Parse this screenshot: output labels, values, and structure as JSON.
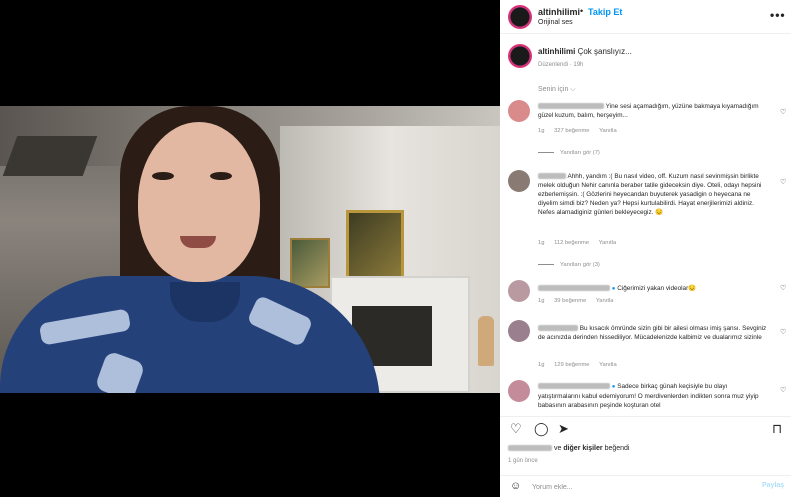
{
  "post": {
    "username": "altinhilimi",
    "follow_label": "Takip Et",
    "audio": "Orijinal ses",
    "more_label": "•••",
    "dot": "•"
  },
  "caption": {
    "username": "altinhilimi",
    "text": "Çok şanslıyız...",
    "meta": "Düzenlendi · 19h"
  },
  "sort_label": "Senin için ⌵",
  "comments": [
    {
      "username": "kullanici1",
      "text": "Yine sesi açamadığım, yüzüne bakmaya kıyamadığım güzel kuzum, balım, herşeyim...",
      "time": "1g",
      "likes": "327 beğenme",
      "reply": "Yanıtla",
      "view_replies": "Yanıtları gör (7)",
      "avatar_color": "#d98a8a"
    },
    {
      "username": "kullanici2",
      "text": "Ahhh, yandım :( Bu nasıl video, off. Kuzum nasıl sevinmişsin birlikte melek olduğun Nehir canınla beraber tatile gideceksin diye. Oteli, odayı hepsini ezberlemişsin. :( Gözlerini heyecandan buyuterek yasadigin o heyecana ne diyelim simdi biz? Neden ya? Hepsi kurtulabilirdi. Hayat enerjilerimizi aldiniz. Nefes alamadiginiz günleri bekleyecegiz. 😔",
      "time": "1g",
      "likes": "112 beğenme",
      "reply": "Yanıtla",
      "view_replies": "Yanıtları gör (3)",
      "avatar_color": "#8a7a74"
    },
    {
      "username": "kullanici3",
      "text": "Ciğerimizi yakan videolar😔",
      "time": "1g",
      "likes": "39 beğenme",
      "reply": "Yanıtla",
      "avatar_color": "#b89aa0"
    },
    {
      "username": "kullanici4",
      "text": "Bu kısacık ömründe sizin gibi bir ailesi olması imiş şansı. Sevginiz de acınızda derinden hissediliyor. Mücadelenizde kalbimiz ve dualarımız sizinle",
      "time": "1g",
      "likes": "129 beğenme",
      "reply": "Yanıtla",
      "avatar_color": "#9a7f8e"
    },
    {
      "username": "kullanici5",
      "text": "Sadece birkaç günah keçisiyle bu olayı yatıştırmalarını kabul edemiyorum! O merdivenlerden indikten sonra muz yiyip babasının arabasının peşinde koşturan otel",
      "time": "",
      "likes": "",
      "reply": "",
      "avatar_color": "#c48c9a"
    }
  ],
  "likes_line": {
    "middle": "ve",
    "others": "diğer kişiler",
    "suffix": "beğendi"
  },
  "time_ago": "1 gün önce",
  "add_comment": {
    "placeholder": "Yorum ekle...",
    "share_label": "Paylaş"
  },
  "icons": {
    "emoji": "☺",
    "heart": "♡",
    "comment": "◯",
    "share": "➤",
    "bookmark": "⊓",
    "sound": "🔈"
  }
}
